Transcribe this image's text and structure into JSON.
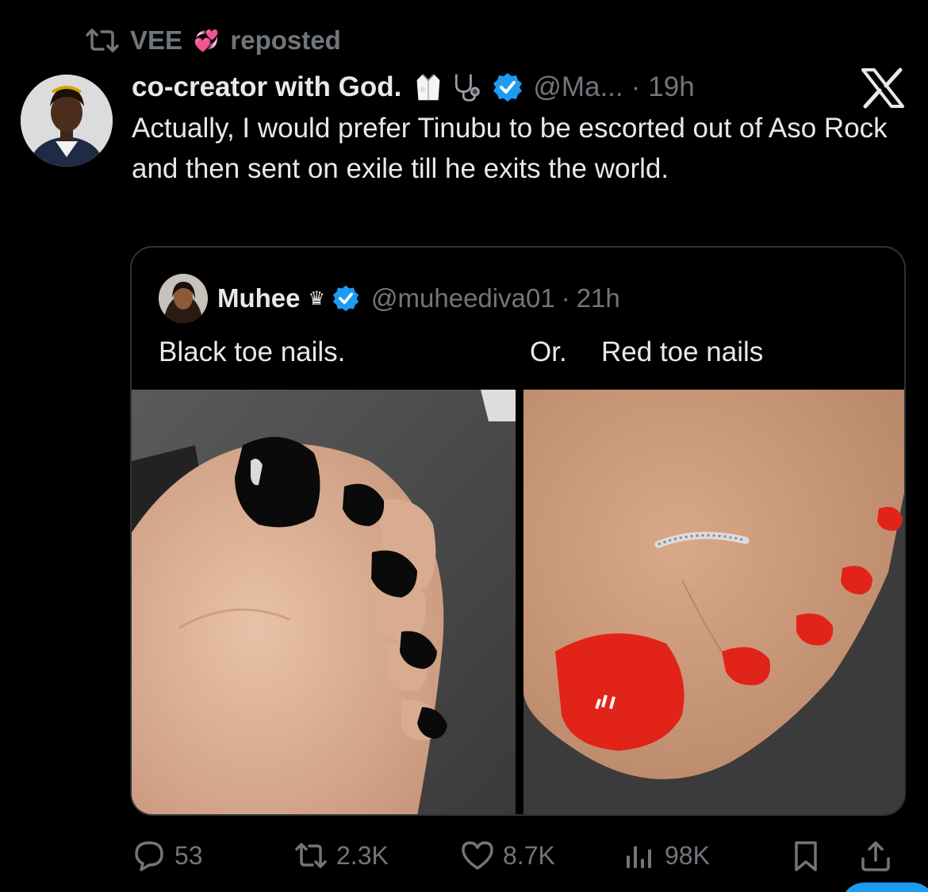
{
  "repost_banner": {
    "user": "VEE",
    "emoji": "💞",
    "action": "reposted",
    "icon": "repost-icon"
  },
  "tweet": {
    "display_name": "co-creator with God.",
    "name_emojis": [
      "lab-coat-emoji",
      "stethoscope-emoji"
    ],
    "handle": "@Ma...",
    "separator": "·",
    "time": "19h",
    "verified": true,
    "text": "Actually, I would prefer Tinubu to be escorted out of Aso Rock and then sent on exile till he exits the world."
  },
  "quote": {
    "display_name": "Muhee",
    "crown": "♛",
    "handle": "@muheediva01",
    "separator": "·",
    "time": "21h",
    "verified": true,
    "text_left": "Black toe nails.",
    "text_or": "Or.",
    "text_right": "Red toe nails",
    "media": [
      {
        "name": "black-toe-nails-photo"
      },
      {
        "name": "red-toe-nails-photo"
      }
    ]
  },
  "actions": {
    "replies": "53",
    "reposts": "2.3K",
    "likes": "8.7K",
    "views": "98K"
  },
  "colors": {
    "background": "#000000",
    "text": "#e7e9ea",
    "muted": "#71767b",
    "verified_blue": "#1d9bf0",
    "border": "#2f3336",
    "red_nail": "#e2231a"
  }
}
